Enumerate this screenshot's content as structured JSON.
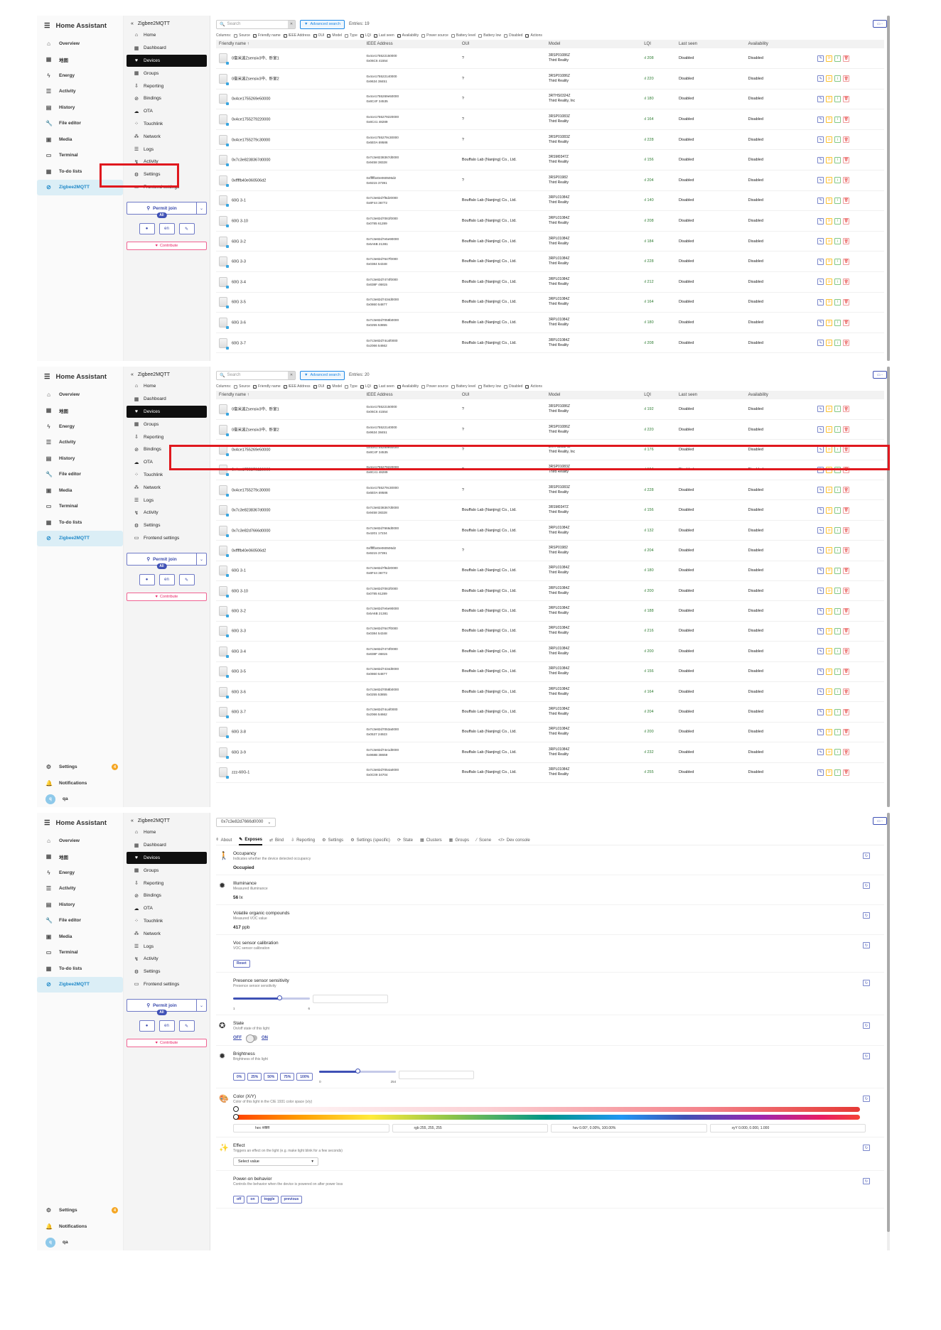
{
  "ha": {
    "title": "Home Assistant",
    "items": [
      {
        "label": "Overview",
        "icon": "home-icon"
      },
      {
        "label": "地图",
        "icon": "map-icon"
      },
      {
        "label": "Energy",
        "icon": "energy-icon"
      },
      {
        "label": "Activity",
        "icon": "activity-icon"
      },
      {
        "label": "History",
        "icon": "history-icon"
      },
      {
        "label": "File editor",
        "icon": "wrench-icon"
      },
      {
        "label": "Media",
        "icon": "media-icon"
      },
      {
        "label": "Terminal",
        "icon": "terminal-icon"
      },
      {
        "label": "To-do lists",
        "icon": "todo-icon"
      },
      {
        "label": "Zigbee2MQTT",
        "icon": "zigbee-icon"
      }
    ],
    "settings": "Settings",
    "settings_badge": "4",
    "notifications": "Notifications",
    "user": "qa",
    "user_initial": "q"
  },
  "z2m": {
    "title": "Zigbee2MQTT",
    "items": [
      "Home",
      "Dashboard",
      "Devices",
      "Groups",
      "Reporting",
      "Bindings",
      "OTA",
      "Touchlink",
      "Network",
      "Logs",
      "Activity",
      "Settings",
      "Frontend settings"
    ],
    "permit_join": "Permit join",
    "permit_all": "All",
    "lang": "en",
    "contribute": "Contribute"
  },
  "toolbar": {
    "search_placeholder": "Search",
    "advanced_search": "Advanced search",
    "entries_1": "Entries: 19",
    "entries_2": "Entries: 20",
    "columns_label": "Columns:",
    "columns": [
      {
        "label": "Source",
        "on": false
      },
      {
        "label": "Friendly name",
        "on": true
      },
      {
        "label": "IEEE Address",
        "on": true
      },
      {
        "label": "OUI",
        "on": true
      },
      {
        "label": "Model",
        "on": true
      },
      {
        "label": "Type",
        "on": false
      },
      {
        "label": "LQI",
        "on": true
      },
      {
        "label": "Last seen",
        "on": true
      },
      {
        "label": "Availability",
        "on": true
      },
      {
        "label": "Power source",
        "on": false
      },
      {
        "label": "Battery level",
        "on": false
      },
      {
        "label": "Battery low",
        "on": false
      },
      {
        "label": "Disabled",
        "on": false
      },
      {
        "label": "Actions",
        "on": true
      }
    ]
  },
  "table": {
    "headers": [
      "Friendly name ↑",
      "IEEE Address",
      "OUI",
      "Model",
      "LQI",
      "Last seen",
      "Availability",
      ""
    ],
    "rows_1": [
      {
        "name": "0毫米波Zsensiv3中、卧室1",
        "ieee": "0x4ce175522150000",
        "nwk": "0x06C6    41554",
        "oui": "?",
        "model": "3RSP01086Z",
        "vendor": "Third Reality",
        "lqi": "208",
        "seen": "Disabled",
        "avail": "Disabled"
      },
      {
        "name": "0毫米波Zsensiv3中、卧室2",
        "ieee": "0x4ce175522140000",
        "nwk": "0x9634    38451",
        "oui": "?",
        "model": "3RSP01086Z",
        "vendor": "Third Reality",
        "lqi": "220",
        "seen": "Disabled",
        "avail": "Disabled"
      },
      {
        "name": "0x4ce1755269e50000",
        "ieee": "0x4ce1755269e50000",
        "nwk": "0x8C4F    34535",
        "oui": "?",
        "model": "3RTHS0324Z",
        "vendor": "Third Reality, Inc",
        "lqi": "180",
        "seen": "Disabled",
        "avail": "Disabled"
      },
      {
        "name": "0x4ce1755279220000",
        "ieee": "0x4ce1755279220000",
        "nwk": "0x8C41    48289",
        "oui": "?",
        "model": "3RSP01083Z",
        "vendor": "Third Reality",
        "lqi": "164",
        "seen": "Disabled",
        "avail": "Disabled"
      },
      {
        "name": "0x4ce1755279c30000",
        "ieee": "0x4ce1755279c30000",
        "nwk": "0x6E0A    69586",
        "oui": "?",
        "model": "3RSP01083Z",
        "vendor": "Third Reality",
        "lqi": "228",
        "seen": "Disabled",
        "avail": "Disabled"
      },
      {
        "name": "0x7c3e8238367d0000",
        "ieee": "0x7c3e8238367d0000",
        "nwk": "0x9458    38328",
        "oui": "Bouffalo Lab (Nanjing) Co., Ltd.",
        "model": "3RSM0347Z",
        "vendor": "Third Reality",
        "lqi": "156",
        "seen": "Disabled",
        "avail": "Disabled"
      },
      {
        "name": "0xffffb40e060506d2",
        "ieee": "0xfffffb40e060506d2",
        "nwk": "0x9215    37391",
        "oui": "?",
        "model": "3RSP01982",
        "vendor": "Third Reality",
        "lqi": "204",
        "seen": "Disabled",
        "avail": "Disabled"
      },
      {
        "name": "60G 3-1",
        "ieee": "0x7c3e82d7f6d20000",
        "nwk": "0x8F44    36772",
        "oui": "Bouffalo Lab (Nanjing) Co., Ltd.",
        "model": "3RPL01084Z",
        "vendor": "Third Reality",
        "lqi": "140",
        "seen": "Disabled",
        "avail": "Disabled"
      },
      {
        "name": "60G 3-10",
        "ieee": "0x7c3e82d7081f0000",
        "nwk": "0x0785    61289",
        "oui": "Bouffalo Lab (Nanjing) Co., Ltd.",
        "model": "3RPL01084Z",
        "vendor": "Third Reality",
        "lqi": "208",
        "seen": "Disabled",
        "avail": "Disabled"
      },
      {
        "name": "60G 3-2",
        "ieee": "0x7c3e82d7e5e90000",
        "nwk": "0x5A6B    21381",
        "oui": "Bouffalo Lab (Nanjing) Co., Ltd.",
        "model": "3RPL01084Z",
        "vendor": "Third Reality",
        "lqi": "184",
        "seen": "Disabled",
        "avail": "Disabled"
      },
      {
        "name": "60G 3-3",
        "ieee": "0x7c3e82d7647f0000",
        "nwk": "0x0384    54348",
        "oui": "Bouffalo Lab (Nanjing) Co., Ltd.",
        "model": "3RPL01084Z",
        "vendor": "Third Reality",
        "lqi": "228",
        "seen": "Disabled",
        "avail": "Disabled"
      },
      {
        "name": "60G 3-4",
        "ieee": "0x7c3e82d7474f0000",
        "nwk": "0x838F    46815",
        "oui": "Bouffalo Lab (Nanjing) Co., Ltd.",
        "model": "3RPL01084Z",
        "vendor": "Third Reality",
        "lqi": "212",
        "seen": "Disabled",
        "avail": "Disabled"
      },
      {
        "name": "60G 3-5",
        "ieee": "0x7c3e82d7434d0000",
        "nwk": "0x0860    54877",
        "oui": "Bouffalo Lab (Nanjing) Co., Ltd.",
        "model": "3RPL01084Z",
        "vendor": "Third Reality",
        "lqi": "164",
        "seen": "Disabled",
        "avail": "Disabled"
      },
      {
        "name": "60G 3-6",
        "ieee": "0x7c3e82d7058b0000",
        "nwk": "0x0255    53855",
        "oui": "Bouffalo Lab (Nanjing) Co., Ltd.",
        "model": "3RPL01084Z",
        "vendor": "Third Reality",
        "lqi": "180",
        "seen": "Disabled",
        "avail": "Disabled"
      },
      {
        "name": "60G 3-7",
        "ieee": "0x7c3e82d74caf0000",
        "nwk": "0x2066    54662",
        "oui": "Bouffalo Lab (Nanjing) Co., Ltd.",
        "model": "3RPL01084Z",
        "vendor": "Third Reality",
        "lqi": "208",
        "seen": "Disabled",
        "avail": "Disabled"
      }
    ],
    "rows_2": [
      {
        "name": "0毫米波Zsensiv3中、卧室1",
        "ieee": "0x4ce175522150000",
        "nwk": "0x06C6    41554",
        "oui": "?",
        "model": "3RSP01086Z",
        "vendor": "Third Reality",
        "lqi": "192",
        "seen": "Disabled",
        "avail": "Disabled"
      },
      {
        "name": "0毫米波Zsensiv3中、卧室2",
        "ieee": "0x4ce175522140000",
        "nwk": "0x9634    38451",
        "oui": "?",
        "model": "3RSP01086Z",
        "vendor": "Third Reality",
        "lqi": "220",
        "seen": "Disabled",
        "avail": "Disabled"
      },
      {
        "name": "0x4ce1755269e50000",
        "ieee": "0x4ce1755269e50000",
        "nwk": "0x8C4F    34535",
        "oui": "?",
        "model": "3RTHS0324Z",
        "vendor": "Third Reality, Inc",
        "lqi": "176",
        "seen": "Disabled",
        "avail": "Disabled"
      },
      {
        "name": "0x4ce1755279220000",
        "ieee": "0x4ce1755279220000",
        "nwk": "0x8C41    48289",
        "oui": "?",
        "model": "3RSP01083Z",
        "vendor": "Third Reality",
        "lqi": "164",
        "seen": "Disabled",
        "avail": "Disabled"
      },
      {
        "name": "0x4ce1755279c30000",
        "ieee": "0x4ce1755279c30000",
        "nwk": "0x6E0A    69586",
        "oui": "?",
        "model": "3RSP01083Z",
        "vendor": "Third Reality",
        "lqi": "228",
        "seen": "Disabled",
        "avail": "Disabled"
      },
      {
        "name": "0x7c3e8238367d0000",
        "ieee": "0x7c3e8238367d0000",
        "nwk": "0x9458    38328",
        "oui": "Bouffalo Lab (Nanjing) Co., Ltd.",
        "model": "3RSM0347Z",
        "vendor": "Third Reality",
        "lqi": "156",
        "seen": "Disabled",
        "avail": "Disabled"
      },
      {
        "name": "0x7c3e82d7666d0000",
        "ieee": "0x7c3e82d7666d0000",
        "nwk": "0x4201    17234",
        "oui": "Bouffalo Lab (Nanjing) Co., Ltd.",
        "model": "3RPL01084Z",
        "vendor": "Third Reality",
        "lqi": "132",
        "seen": "Disabled",
        "avail": "Disabled"
      },
      {
        "name": "0xffffb40e060506d2",
        "ieee": "0xfffffb40e060506d2",
        "nwk": "0x9215    37391",
        "oui": "?",
        "model": "3RSP01982",
        "vendor": "Third Reality",
        "lqi": "204",
        "seen": "Disabled",
        "avail": "Disabled"
      },
      {
        "name": "60G 3-1",
        "ieee": "0x7c3e82d7f6d20000",
        "nwk": "0x8F44    36772",
        "oui": "Bouffalo Lab (Nanjing) Co., Ltd.",
        "model": "3RPL01084Z",
        "vendor": "Third Reality",
        "lqi": "180",
        "seen": "Disabled",
        "avail": "Disabled"
      },
      {
        "name": "60G 3-10",
        "ieee": "0x7c3e82d7081f0000",
        "nwk": "0x0785    61289",
        "oui": "Bouffalo Lab (Nanjing) Co., Ltd.",
        "model": "3RPL01084Z",
        "vendor": "Third Reality",
        "lqi": "200",
        "seen": "Disabled",
        "avail": "Disabled"
      },
      {
        "name": "60G 3-2",
        "ieee": "0x7c3e82d7e5e90000",
        "nwk": "0x5A6B    21381",
        "oui": "Bouffalo Lab (Nanjing) Co., Ltd.",
        "model": "3RPL01084Z",
        "vendor": "Third Reality",
        "lqi": "188",
        "seen": "Disabled",
        "avail": "Disabled"
      },
      {
        "name": "60G 3-3",
        "ieee": "0x7c3e82d7647f0000",
        "nwk": "0x0384    54348",
        "oui": "Bouffalo Lab (Nanjing) Co., Ltd.",
        "model": "3RPL01084Z",
        "vendor": "Third Reality",
        "lqi": "216",
        "seen": "Disabled",
        "avail": "Disabled"
      },
      {
        "name": "60G 3-4",
        "ieee": "0x7c3e82d7474f0000",
        "nwk": "0x838F    46815",
        "oui": "Bouffalo Lab (Nanjing) Co., Ltd.",
        "model": "3RPL01084Z",
        "vendor": "Third Reality",
        "lqi": "200",
        "seen": "Disabled",
        "avail": "Disabled"
      },
      {
        "name": "60G 3-5",
        "ieee": "0x7c3e82d7434d0000",
        "nwk": "0x0860    54877",
        "oui": "Bouffalo Lab (Nanjing) Co., Ltd.",
        "model": "3RPL01084Z",
        "vendor": "Third Reality",
        "lqi": "156",
        "seen": "Disabled",
        "avail": "Disabled"
      },
      {
        "name": "60G 3-6",
        "ieee": "0x7c3e82d7058b0000",
        "nwk": "0x0255    53855",
        "oui": "Bouffalo Lab (Nanjing) Co., Ltd.",
        "model": "3RPL01084Z",
        "vendor": "Third Reality",
        "lqi": "164",
        "seen": "Disabled",
        "avail": "Disabled"
      },
      {
        "name": "60G 3-7",
        "ieee": "0x7c3e82d74caf0000",
        "nwk": "0x2066    54662",
        "oui": "Bouffalo Lab (Nanjing) Co., Ltd.",
        "model": "3RPL01084Z",
        "vendor": "Third Reality",
        "lqi": "204",
        "seen": "Disabled",
        "avail": "Disabled"
      },
      {
        "name": "60G 3-8",
        "ieee": "0x7c3e82d7053a0000",
        "nwk": "0x0537    24923",
        "oui": "Bouffalo Lab (Nanjing) Co., Ltd.",
        "model": "3RPL01084Z",
        "vendor": "Third Reality",
        "lqi": "200",
        "seen": "Disabled",
        "avail": "Disabled"
      },
      {
        "name": "60G 3-9",
        "ieee": "0x7c3e82d74e1d0000",
        "nwk": "0x968B    38659",
        "oui": "Bouffalo Lab (Nanjing) Co., Ltd.",
        "model": "3RPL01084Z",
        "vendor": "Third Reality",
        "lqi": "232",
        "seen": "Disabled",
        "avail": "Disabled"
      },
      {
        "name": "zzz-60G-1",
        "ieee": "0x7c3e82d7054a0000",
        "nwk": "0x0C09    34704",
        "oui": "Bouffalo Lab (Nanjing) Co., Ltd.",
        "model": "3RPL01084Z",
        "vendor": "Third Reality",
        "lqi": "255",
        "seen": "Disabled",
        "avail": "Disabled"
      }
    ]
  },
  "detail": {
    "device": "0x7c3e82d7666d0000",
    "tabs": [
      "About",
      "Exposes",
      "Bind",
      "Reporting",
      "Settings",
      "Settings (specific)",
      "State",
      "Clusters",
      "Groups",
      "Scene",
      "Dev console"
    ],
    "active_tab": "Exposes",
    "occupancy": {
      "title": "Occupancy",
      "desc": "Indicates whether the device detected occupancy",
      "value": "Occupied"
    },
    "illuminance": {
      "title": "Illuminance",
      "desc": "Measured illuminance",
      "value": "56",
      "unit": "lx"
    },
    "voc": {
      "title": "Volatile organic compounds",
      "desc": "Measured VOC value",
      "value": "417",
      "unit": "ppb"
    },
    "voc_cal": {
      "title": "Voc sensor calibration",
      "desc": "VOC sensor calibration",
      "button": "Reset"
    },
    "presence": {
      "title": "Presence sensor sensitivity",
      "desc": "Presence sensor sensitivity",
      "min": "1",
      "max": "6",
      "level": 0.6
    },
    "state": {
      "title": "State",
      "desc": "On/off state of this light",
      "off": "OFF",
      "on": "ON"
    },
    "brightness": {
      "title": "Brightness",
      "desc": "Brightness of this light",
      "presets": [
        "0%",
        "25%",
        "50%",
        "75%",
        "100%"
      ],
      "min": "0",
      "max": "254",
      "level": 0.5
    },
    "color": {
      "title": "Color (X/Y)",
      "desc": "Color of this light in the CIE 1931 color space (x/y)",
      "hex": "hex  #ffffff",
      "rgb": "rgb  255, 255, 255",
      "hsv": "hsv  0.00°, 0.00%, 100.00%",
      "xyy": "xyY  0.000, 0.000, 1.000"
    },
    "effect": {
      "title": "Effect",
      "desc": "Triggers an effect on the light (e.g. make light blink for a few seconds)",
      "select": "Select value"
    },
    "power_on": {
      "title": "Power-on behavior",
      "desc": "Controls the behavior when the device is powered on after power loss",
      "options": [
        "off",
        "on",
        "toggle",
        "previous"
      ]
    }
  },
  "colors": {
    "accent": "#3f51b5",
    "highlight": "#e0181e",
    "active_nav": "#1e88c8"
  }
}
